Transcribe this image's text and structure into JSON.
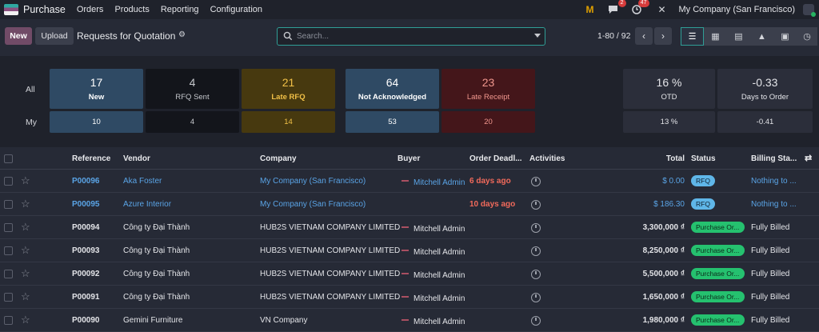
{
  "app": {
    "name": "Purchase"
  },
  "nav": {
    "menu": [
      "Orders",
      "Products",
      "Reporting",
      "Configuration"
    ],
    "chat_badge": "2",
    "activity_badge": "47",
    "company": "My Company (San Francisco)"
  },
  "toolbar": {
    "new_label": "New",
    "upload_label": "Upload",
    "title": "Requests for Quotation",
    "search_placeholder": "Search...",
    "pager": "1-80 / 92"
  },
  "dashboard": {
    "row_all": "All",
    "row_my": "My",
    "tiles": [
      {
        "value": "17",
        "label": "New",
        "my": "10"
      },
      {
        "value": "4",
        "label": "RFQ Sent",
        "my": "4"
      },
      {
        "value": "21",
        "label": "Late RFQ",
        "my": "14"
      },
      {
        "value": "64",
        "label": "Not Acknowledged",
        "my": "53"
      },
      {
        "value": "23",
        "label": "Late Receipt",
        "my": "20"
      }
    ],
    "kpis": [
      {
        "value": "16 %",
        "label": "OTD",
        "my": "13 %"
      },
      {
        "value": "-0.33",
        "label": "Days to Order",
        "my": "-0.41"
      }
    ]
  },
  "table": {
    "headers": {
      "reference": "Reference",
      "vendor": "Vendor",
      "company": "Company",
      "buyer": "Buyer",
      "deadline": "Order Deadl...",
      "activities": "Activities",
      "total": "Total",
      "status": "Status",
      "billing": "Billing Sta..."
    },
    "rows": [
      {
        "reference": "P00096",
        "vendor": "Aka Foster",
        "company": "My Company (San Francisco)",
        "buyer": "Mitchell Admin",
        "deadline": "6 days ago",
        "total": "$ 0.00",
        "status": "RFQ",
        "billing": "Nothing to ..."
      },
      {
        "reference": "P00095",
        "vendor": "Azure Interior",
        "company": "My Company (San Francisco)",
        "buyer": "",
        "deadline": "10 days ago",
        "total": "$ 186.30",
        "status": "RFQ",
        "billing": "Nothing to ..."
      },
      {
        "reference": "P00094",
        "vendor": "Công ty Đại Thành",
        "company": "HUB2S VIETNAM COMPANY LIMITED",
        "buyer": "Mitchell Admin",
        "deadline": "",
        "total": "3,300,000 ₫",
        "status": "Purchase Or...",
        "billing": "Fully Billed"
      },
      {
        "reference": "P00093",
        "vendor": "Công ty Đại Thành",
        "company": "HUB2S VIETNAM COMPANY LIMITED",
        "buyer": "Mitchell Admin",
        "deadline": "",
        "total": "8,250,000 ₫",
        "status": "Purchase Or...",
        "billing": "Fully Billed"
      },
      {
        "reference": "P00092",
        "vendor": "Công ty Đại Thành",
        "company": "HUB2S VIETNAM COMPANY LIMITED",
        "buyer": "Mitchell Admin",
        "deadline": "",
        "total": "5,500,000 ₫",
        "status": "Purchase Or...",
        "billing": "Fully Billed"
      },
      {
        "reference": "P00091",
        "vendor": "Công ty Đại Thành",
        "company": "HUB2S VIETNAM COMPANY LIMITED",
        "buyer": "Mitchell Admin",
        "deadline": "",
        "total": "1,650,000 ₫",
        "status": "Purchase Or...",
        "billing": "Fully Billed"
      },
      {
        "reference": "P00090",
        "vendor": "Gemini Furniture",
        "company": "VN Company",
        "buyer": "Mitchell Admin",
        "deadline": "",
        "total": "1,980,000 ₫",
        "status": "Purchase Or...",
        "billing": "Fully Billed"
      }
    ]
  }
}
